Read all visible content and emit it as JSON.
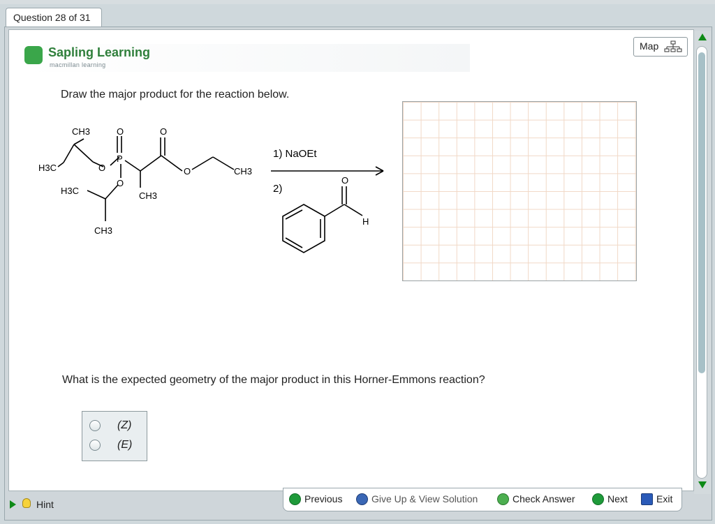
{
  "question_tab": {
    "label": "Question 28 of 31"
  },
  "brand": {
    "name": "Sapling Learning",
    "sub": "macmillan learning"
  },
  "map": {
    "label": "Map"
  },
  "prompt": {
    "text": "Draw the major product for the reaction below."
  },
  "reaction": {
    "reactant_labels": {
      "ch3_top": "CH3",
      "o_top1": "O",
      "o_top2": "O",
      "h3c_left": "H3C",
      "o_ring1": "O",
      "p": "P",
      "o_ester": "O",
      "ch3_right": "CH3",
      "h3c_lower": "H3C",
      "o_lower": "O",
      "ch3_center": "CH3",
      "ch3_bottom": "CH3"
    },
    "step1": "1) NaOEt",
    "step2": "2)",
    "aldehyde_o": "O",
    "aldehyde_h": "H"
  },
  "question2": {
    "text": "What is the expected geometry of the major product in this Horner-Emmons reaction?"
  },
  "choices": [
    {
      "label": "(Z)"
    },
    {
      "label": "(E)"
    }
  ],
  "hint": {
    "label": "Hint"
  },
  "nav": {
    "previous": "Previous",
    "give_up": "Give Up & View Solution",
    "check": "Check Answer",
    "next": "Next",
    "exit": "Exit"
  }
}
